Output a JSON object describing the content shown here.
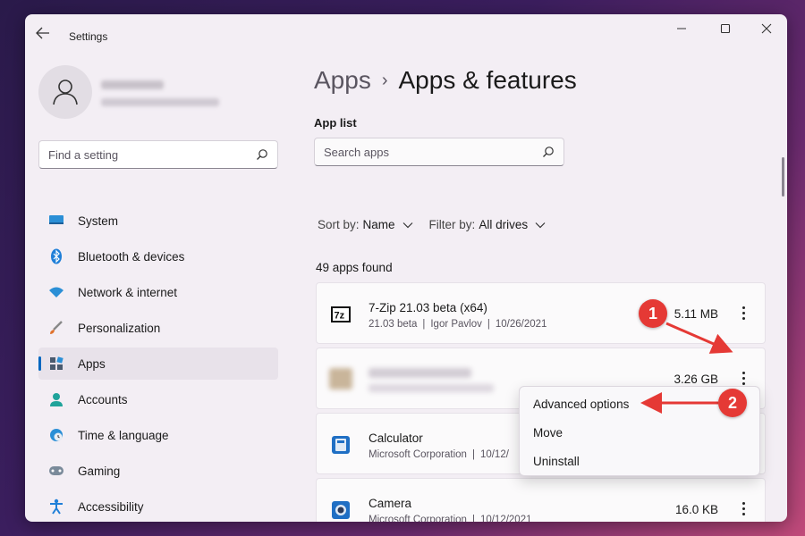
{
  "window": {
    "title": "Settings",
    "controls": [
      "minimize",
      "maximize",
      "close"
    ]
  },
  "sidebar": {
    "search_placeholder": "Find a setting",
    "items": [
      {
        "label": "System",
        "icon": "monitor-icon",
        "active": false
      },
      {
        "label": "Bluetooth & devices",
        "icon": "bluetooth-icon",
        "active": false
      },
      {
        "label": "Network & internet",
        "icon": "wifi-icon",
        "active": false
      },
      {
        "label": "Personalization",
        "icon": "brush-icon",
        "active": false
      },
      {
        "label": "Apps",
        "icon": "apps-icon",
        "active": true
      },
      {
        "label": "Accounts",
        "icon": "person-icon",
        "active": false
      },
      {
        "label": "Time & language",
        "icon": "globe-clock-icon",
        "active": false
      },
      {
        "label": "Gaming",
        "icon": "gamepad-icon",
        "active": false
      },
      {
        "label": "Accessibility",
        "icon": "accessibility-icon",
        "active": false
      }
    ]
  },
  "main": {
    "breadcrumb_parent": "Apps",
    "breadcrumb_separator": "›",
    "page_title": "Apps & features",
    "app_list_label": "App list",
    "search_placeholder": "Search apps",
    "sort_key": "Sort by:",
    "sort_value": "Name",
    "filter_key": "Filter by:",
    "filter_value": "All drives",
    "count_text": "49 apps found",
    "apps": [
      {
        "name": "7-Zip 21.03 beta (x64)",
        "version": "21.03 beta",
        "publisher": "Igor Pavlov",
        "date": "10/26/2021",
        "size": "5.11 MB",
        "icon": "7zip-icon"
      },
      {
        "name": "",
        "version": "",
        "publisher": "",
        "date": "",
        "size": "3.26 GB",
        "icon": "blurred-app-icon"
      },
      {
        "name": "Calculator",
        "version": "",
        "publisher": "Microsoft Corporation",
        "date": "10/12/",
        "size": "",
        "icon": "calculator-icon"
      },
      {
        "name": "Camera",
        "version": "",
        "publisher": "Microsoft Corporation",
        "date": "10/12/2021",
        "size": "16.0 KB",
        "icon": "camera-icon"
      }
    ]
  },
  "context_menu": {
    "items": [
      "Advanced options",
      "Move",
      "Uninstall"
    ]
  },
  "annotations": [
    "1",
    "2"
  ],
  "colors": {
    "accent": "#0067c0",
    "annotation": "#e53935"
  }
}
